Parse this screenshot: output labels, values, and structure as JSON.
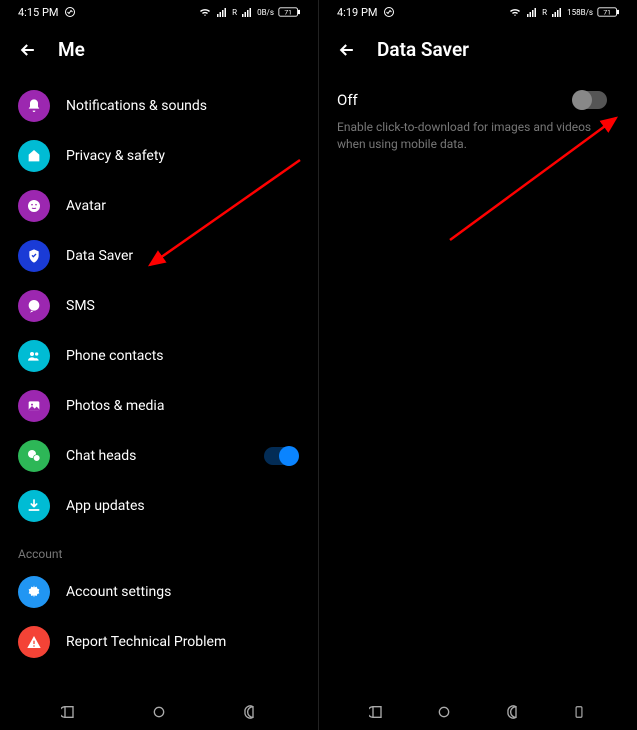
{
  "left": {
    "status": {
      "time": "4:15 PM",
      "net": "R",
      "speed": "0B/s",
      "battery": "71"
    },
    "header": {
      "title": "Me"
    },
    "items": [
      {
        "label": "Notifications & sounds",
        "icon": "bell",
        "color": "ic-purple"
      },
      {
        "label": "Privacy & safety",
        "icon": "house-lock",
        "color": "ic-cyan"
      },
      {
        "label": "Avatar",
        "icon": "face",
        "color": "ic-purple"
      },
      {
        "label": "Data Saver",
        "icon": "shield",
        "color": "ic-blue"
      },
      {
        "label": "SMS",
        "icon": "chat",
        "color": "ic-purple"
      },
      {
        "label": "Phone contacts",
        "icon": "people",
        "color": "ic-cyan"
      },
      {
        "label": "Photos & media",
        "icon": "photo",
        "color": "ic-purple"
      },
      {
        "label": "Chat heads",
        "icon": "bubble",
        "color": "ic-green",
        "toggle": true,
        "on": true
      },
      {
        "label": "App updates",
        "icon": "download",
        "color": "ic-cyan"
      }
    ],
    "section": "Account",
    "account_items": [
      {
        "label": "Account settings",
        "icon": "gear",
        "color": "ic-lblue"
      },
      {
        "label": "Report Technical Problem",
        "icon": "warn",
        "color": "ic-red"
      }
    ]
  },
  "right": {
    "status": {
      "time": "4:19 PM",
      "net": "R",
      "speed": "158B/s",
      "battery": "71"
    },
    "header": {
      "title": "Data Saver"
    },
    "state": "Off",
    "desc": "Enable click-to-download for images and videos when using mobile data."
  }
}
